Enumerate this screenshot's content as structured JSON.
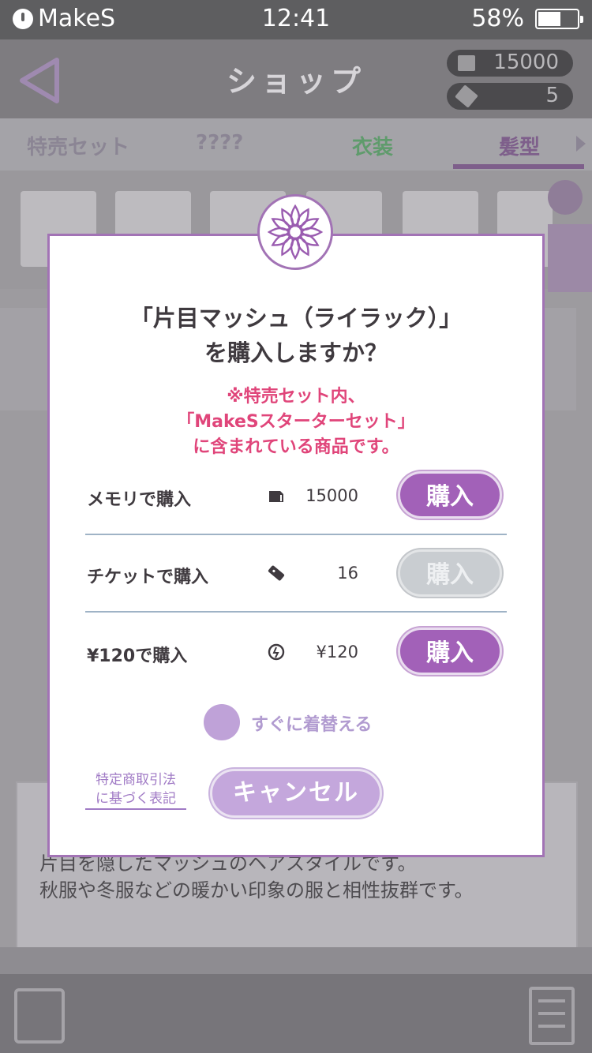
{
  "status_bar": {
    "carrier": "MakeS",
    "time": "12:41",
    "battery": "58%",
    "battery_level": 0.58
  },
  "header": {
    "title": "ショップ",
    "currency_memory": "15000",
    "currency_ticket": "5"
  },
  "tabs": [
    {
      "label": "特売セット",
      "color": "#8b8594"
    },
    {
      "label": "????",
      "color": "#8b8594"
    },
    {
      "label": "衣装",
      "color": "#5f9b6c"
    },
    {
      "label": "髪型",
      "color": "#7e5f8b"
    }
  ],
  "background_description": {
    "line1": "片目を隠したマッシュのヘアスタイルです。",
    "line2": "秋服や冬服などの暖かい印象の服と相性抜群です。"
  },
  "dialog": {
    "question_line1": "「片目マッシュ（ライラック）」",
    "question_line2": "を購入しますか？",
    "note_line1": "※特売セット内、",
    "note_line2": "「MakeSスターターセット」",
    "note_line3": "に含まれている商品です。",
    "options": [
      {
        "label": "メモリで購入",
        "icon": "memory-card-icon",
        "value": "15000",
        "button": "購入",
        "enabled": true
      },
      {
        "label": "チケットで購入",
        "icon": "ticket-icon",
        "value": "16",
        "button": "購入",
        "enabled": false
      },
      {
        "label": "¥120で購入",
        "icon": "yen-coin-icon",
        "value": "¥120",
        "button": "購入",
        "enabled": true
      }
    ],
    "equip_now_label": "すぐに着替える",
    "law_link_line1": "特定商取引法",
    "law_link_line2": "に基づく表記",
    "cancel_label": "キャンセル"
  },
  "colors": {
    "accent": "#a261b8",
    "note": "#e0457a",
    "disabled": "#c9cdd1"
  }
}
